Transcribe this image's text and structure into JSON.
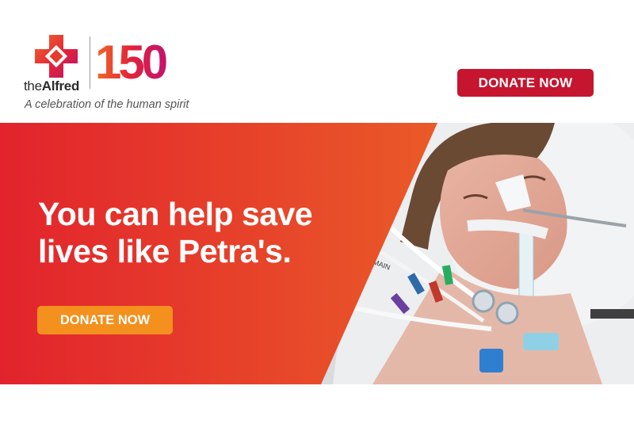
{
  "header": {
    "logo": {
      "name_prefix": "the",
      "name_main": "Alfred",
      "anniversary": "150"
    },
    "tagline": "A celebration of the human spirit",
    "donate_label": "DONATE NOW"
  },
  "hero": {
    "headline_line1": "You can help save",
    "headline_line2": "lives like Petra's.",
    "donate_label": "DONATE NOW",
    "photo_text": "MAIN"
  },
  "colors": {
    "brand_red": "#c5152f",
    "hero_red": "#e2232d",
    "hero_orange": "#ea5a28",
    "button_orange": "#f3901e",
    "logo_orange": "#f05a28",
    "logo_magenta": "#c4126e"
  }
}
